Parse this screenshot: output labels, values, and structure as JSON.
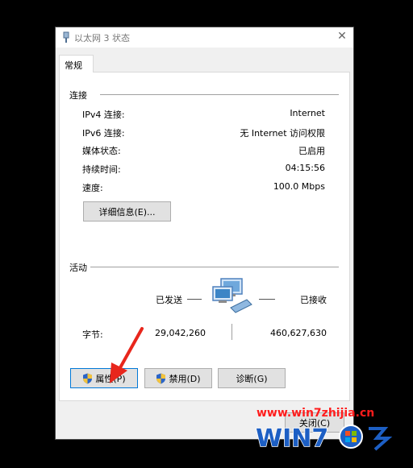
{
  "window": {
    "title": "以太网 3 状态"
  },
  "tabs": [
    {
      "label": "常规"
    }
  ],
  "connection": {
    "group_label": "连接",
    "rows": [
      {
        "label": "IPv4 连接:",
        "value": "Internet"
      },
      {
        "label": "IPv6 连接:",
        "value": "无 Internet 访问权限"
      },
      {
        "label": "媒体状态:",
        "value": "已启用"
      },
      {
        "label": "持续时间:",
        "value": "04:15:56"
      },
      {
        "label": "速度:",
        "value": "100.0 Mbps"
      }
    ],
    "details_button": "详细信息(E)..."
  },
  "activity": {
    "group_label": "活动",
    "sent_label": "已发送",
    "received_label": "已接收",
    "bytes_label": "字节:",
    "bytes_sent": "29,042,260",
    "bytes_received": "460,627,630"
  },
  "buttons": {
    "properties": "属性(P)",
    "disable": "禁用(D)",
    "diagnose": "诊断(G)",
    "close": "关闭(C)"
  },
  "watermark": {
    "url": "www.win7zhijia.cn",
    "logo_text": "WIN7"
  },
  "colors": {
    "arrow": "#e8261c",
    "accent": "#0078d7",
    "watermark": "#ff1c1c"
  }
}
